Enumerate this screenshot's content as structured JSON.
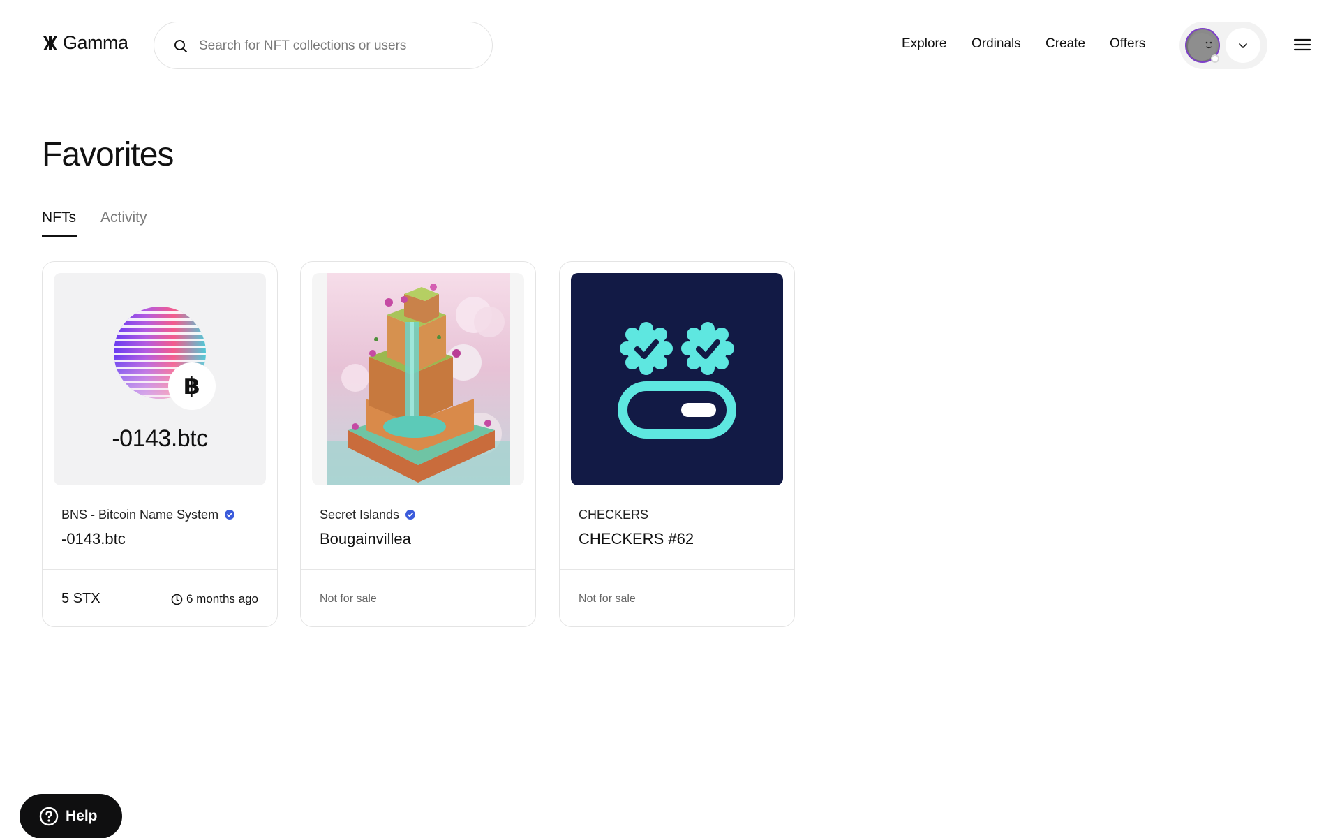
{
  "header": {
    "logo_text": "Gamma",
    "search": {
      "placeholder": "Search for NFT collections or users",
      "value": ""
    },
    "nav": [
      "Explore",
      "Ordinals",
      "Create",
      "Offers"
    ]
  },
  "page": {
    "title": "Favorites",
    "tabs": [
      {
        "label": "NFTs",
        "active": true
      },
      {
        "label": "Activity",
        "active": false
      }
    ]
  },
  "cards": [
    {
      "media_label": "-0143.btc",
      "media_badge": "฿",
      "collection": "BNS - Bitcoin Name System",
      "verified": true,
      "name": "-0143.btc",
      "price": "5 STX",
      "time": "6 months ago"
    },
    {
      "collection": "Secret Islands",
      "verified": true,
      "name": "Bougainvillea",
      "status": "Not for sale"
    },
    {
      "collection": "CHECKERS",
      "verified": false,
      "name": "CHECKERS #62",
      "status": "Not for sale"
    }
  ],
  "help": {
    "label": "Help"
  },
  "colors": {
    "verified": "#3b5bdb",
    "checkers_bg": "#121a45",
    "checkers_fg": "#5ee7e0",
    "help_bg": "#0f0f10"
  },
  "icons": {
    "search": "search-icon",
    "verified": "verified-badge-icon",
    "clock": "clock-icon",
    "chevron": "chevron-down-icon",
    "menu": "hamburger-menu-icon",
    "help": "help-circle-icon"
  }
}
